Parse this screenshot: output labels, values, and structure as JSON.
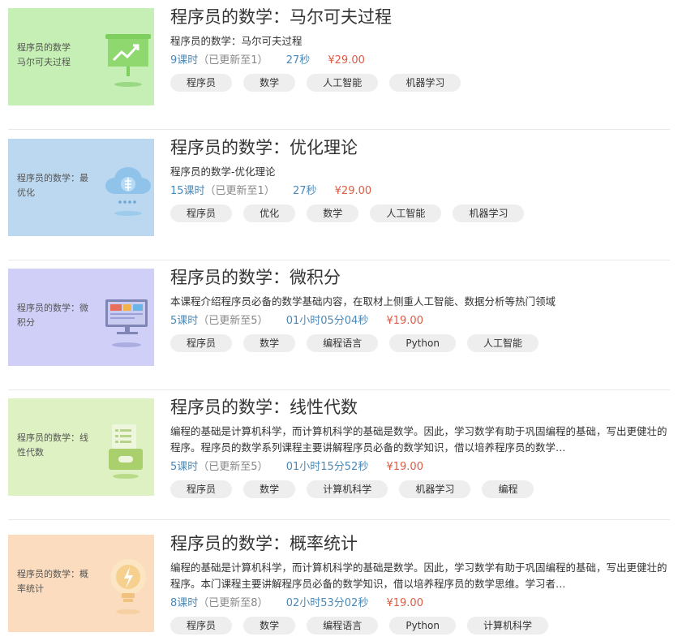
{
  "courses": [
    {
      "thumb_text": "程序员的数学\n马尔可夫过程",
      "thumb_bg": "#c5efb4",
      "title": "程序员的数学：马尔可夫过程",
      "desc": "程序员的数学：马尔可夫过程",
      "lessons": "9课时",
      "updated": "（已更新至1）",
      "duration": "27秒",
      "price": "¥29.00",
      "tags": [
        "程序员",
        "数学",
        "人工智能",
        "机器学习"
      ]
    },
    {
      "thumb_text": "程序员的数学：最优化",
      "thumb_bg": "#bcd8f0",
      "title": "程序员的数学：优化理论",
      "desc": "程序员的数学-优化理论",
      "lessons": "15课时",
      "updated": "（已更新至1）",
      "duration": "27秒",
      "price": "¥29.00",
      "tags": [
        "程序员",
        "优化",
        "数学",
        "人工智能",
        "机器学习"
      ]
    },
    {
      "thumb_text": "程序员的数学：微积分",
      "thumb_bg": "#cfcff7",
      "title": "程序员的数学：微积分",
      "desc": "本课程介绍程序员必备的数学基础内容，在取材上侧重人工智能、数据分析等热门领域",
      "lessons": "5课时",
      "updated": "（已更新至5）",
      "duration": "01小时05分04秒",
      "price": "¥19.00",
      "tags": [
        "程序员",
        "数学",
        "编程语言",
        "Python",
        "人工智能"
      ]
    },
    {
      "thumb_text": "程序员的数学：线性代数",
      "thumb_bg": "#def1c2",
      "title": "程序员的数学：线性代数",
      "desc": "编程的基础是计算机科学，而计算机科学的基础是数学。因此，学习数学有助于巩固编程的基础，写出更健壮的程序。程序员的数学系列课程主要讲解程序员必备的数学知识，借以培养程序员的数学…",
      "lessons": "5课时",
      "updated": "（已更新至5）",
      "duration": "01小时15分52秒",
      "price": "¥19.00",
      "tags": [
        "程序员",
        "数学",
        "计算机科学",
        "机器学习",
        "编程"
      ]
    },
    {
      "thumb_text": "程序员的数学：概率统计",
      "thumb_bg": "#fcdcbf",
      "title": "程序员的数学：概率统计",
      "desc": "编程的基础是计算机科学，而计算机科学的基础是数学。因此，学习数学有助于巩固编程的基础，写出更健壮的程序。本门课程主要讲解程序员必备的数学知识，借以培养程序员的数学思维。学习者…",
      "lessons": "8课时",
      "updated": "（已更新至8）",
      "duration": "02小时53分02秒",
      "price": "¥19.00",
      "tags": [
        "程序员",
        "数学",
        "编程语言",
        "Python",
        "计算机科学"
      ]
    }
  ],
  "icons": [
    "presentation-chart-icon",
    "cloud-brain-icon",
    "monitor-dashboard-icon",
    "folder-document-icon",
    "lightbulb-icon"
  ],
  "colors": {
    "link_blue": "#4a89b8",
    "price_red": "#e05a43",
    "tag_bg": "#eeeeee",
    "divider": "#e9e9e9"
  }
}
